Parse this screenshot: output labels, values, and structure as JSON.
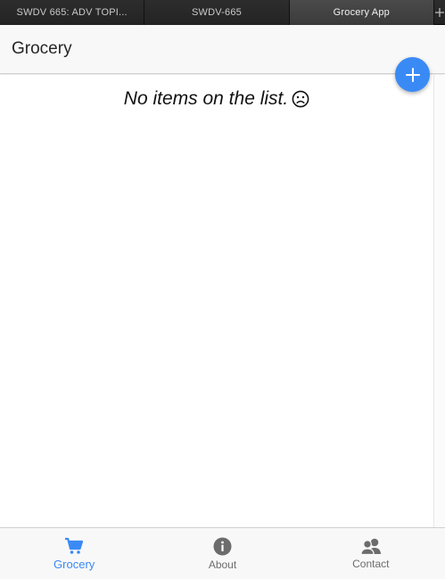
{
  "browser": {
    "tabs": [
      {
        "label": "SWDV 665: ADV TOPI...",
        "active": false
      },
      {
        "label": "SWDV-665",
        "active": false
      },
      {
        "label": "Grocery App",
        "active": true
      }
    ],
    "new_tab_icon": "plus-icon"
  },
  "header": {
    "title": "Grocery"
  },
  "fab": {
    "icon": "plus-icon",
    "color": "#3a8af5"
  },
  "main": {
    "empty_message": "No items on the list.",
    "empty_icon": "sad-face-icon"
  },
  "bottom_tabs": [
    {
      "label": "Grocery",
      "icon": "cart-icon",
      "active": true
    },
    {
      "label": "About",
      "icon": "info-icon",
      "active": false
    },
    {
      "label": "Contact",
      "icon": "people-icon",
      "active": false
    }
  ],
  "colors": {
    "accent": "#3a8af5",
    "inactive_tab": "#6c6c6c"
  }
}
